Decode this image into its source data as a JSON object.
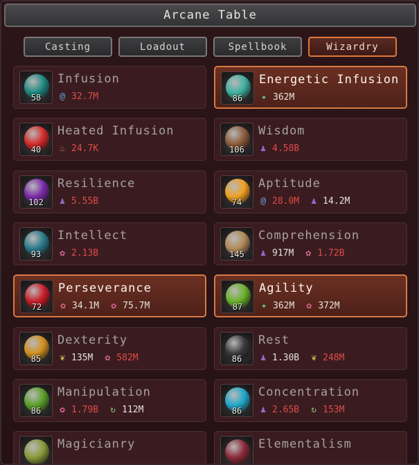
{
  "window": {
    "title": "Arcane Table"
  },
  "tabs": [
    {
      "label": "Casting",
      "active": false
    },
    {
      "label": "Loadout",
      "active": false
    },
    {
      "label": "Spellbook",
      "active": false
    },
    {
      "label": "Wizardry",
      "active": true
    }
  ],
  "spells": [
    {
      "name": "Infusion",
      "level": "58",
      "active": false,
      "orb": "#1f8a82",
      "costs": [
        {
          "icon": "swirl-icon",
          "value": "32.7M",
          "ok": false
        }
      ]
    },
    {
      "name": "Energetic Infusion",
      "level": "86",
      "active": true,
      "orb": "#3fb0a0",
      "costs": [
        {
          "icon": "star-icon",
          "value": "362M",
          "ok": true
        }
      ]
    },
    {
      "name": "Heated Infusion",
      "level": "40",
      "active": false,
      "orb": "#d42a2a",
      "costs": [
        {
          "icon": "flame-icon",
          "value": "24.7K",
          "ok": false
        }
      ]
    },
    {
      "name": "Wisdom",
      "level": "106",
      "active": false,
      "orb": "#8a5a3a",
      "costs": [
        {
          "icon": "person-icon",
          "value": "4.58B",
          "ok": false
        }
      ]
    },
    {
      "name": "Resilience",
      "level": "102",
      "active": false,
      "orb": "#7a2aa8",
      "costs": [
        {
          "icon": "person-icon",
          "value": "5.55B",
          "ok": false
        }
      ]
    },
    {
      "name": "Aptitude",
      "level": "74",
      "active": false,
      "orb": "#f0a020",
      "costs": [
        {
          "icon": "swirl-icon",
          "value": "28.0M",
          "ok": false
        },
        {
          "icon": "person-icon",
          "value": "14.2M",
          "ok": true
        }
      ]
    },
    {
      "name": "Intellect",
      "level": "93",
      "active": false,
      "orb": "#2a7a8a",
      "costs": [
        {
          "icon": "flower-icon",
          "value": "2.13B",
          "ok": false
        }
      ]
    },
    {
      "name": "Comprehension",
      "level": "145",
      "active": false,
      "orb": "#b08a5a",
      "costs": [
        {
          "icon": "person-icon",
          "value": "917M",
          "ok": true
        },
        {
          "icon": "flower-icon",
          "value": "1.72B",
          "ok": false
        }
      ]
    },
    {
      "name": "Perseverance",
      "level": "72",
      "active": true,
      "orb": "#c81e2a",
      "costs": [
        {
          "icon": "flower-icon",
          "value": "34.1M",
          "ok": true
        },
        {
          "icon": "flower-icon",
          "value": "75.7M",
          "ok": true
        }
      ]
    },
    {
      "name": "Agility",
      "level": "87",
      "active": true,
      "orb": "#6ab02a",
      "costs": [
        {
          "icon": "star-icon",
          "value": "362M",
          "ok": true
        },
        {
          "icon": "flower-icon",
          "value": "372M",
          "ok": true
        }
      ]
    },
    {
      "name": "Dexterity",
      "level": "85",
      "active": false,
      "orb": "#d09020",
      "costs": [
        {
          "icon": "leaf-icon",
          "value": "135M",
          "ok": true
        },
        {
          "icon": "flower-icon",
          "value": "582M",
          "ok": false
        }
      ]
    },
    {
      "name": "Rest",
      "level": "86",
      "active": false,
      "orb": "#3a3a3c",
      "costs": [
        {
          "icon": "person-icon",
          "value": "1.30B",
          "ok": true
        },
        {
          "icon": "leaf-icon",
          "value": "248M",
          "ok": false
        }
      ]
    },
    {
      "name": "Manipulation",
      "level": "86",
      "active": false,
      "orb": "#5aa02a",
      "costs": [
        {
          "icon": "flower-icon",
          "value": "1.79B",
          "ok": false
        },
        {
          "icon": "cycle-icon",
          "value": "112M",
          "ok": true
        }
      ]
    },
    {
      "name": "Concentration",
      "level": "86",
      "active": false,
      "orb": "#20a8c8",
      "costs": [
        {
          "icon": "person-icon",
          "value": "2.65B",
          "ok": false
        },
        {
          "icon": "cycle-icon",
          "value": "153M",
          "ok": false
        }
      ]
    },
    {
      "name": "Magicianry",
      "level": "",
      "active": false,
      "orb": "#8a9a3a",
      "costs": []
    },
    {
      "name": "Elementalism",
      "level": "",
      "active": false,
      "orb": "#8a2a3a",
      "costs": []
    }
  ]
}
